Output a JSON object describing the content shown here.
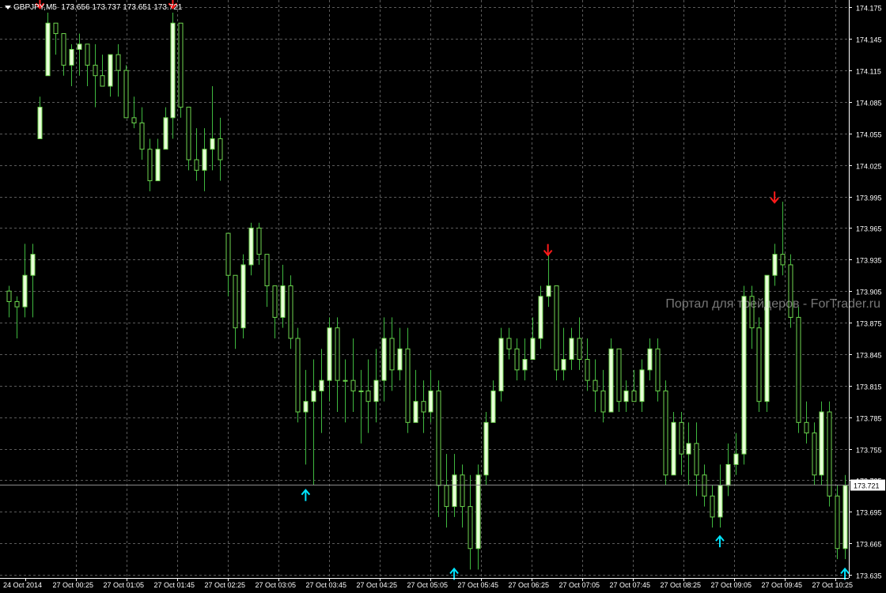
{
  "header": {
    "symbol": "GBPJPY,M5",
    "open": "173.656",
    "high": "173.737",
    "low": "173.651",
    "close": "173.721"
  },
  "watermark": "Портал для трейдеров - ForTrader.ru",
  "current_price_label": "173.721",
  "colors": {
    "background": "#000000",
    "grid": "#5a5a5a",
    "bull_body": "#e8ffd8",
    "bear_body": "#000000",
    "candle_outline": "#6fd64f",
    "wick": "#3fb83f",
    "axis_text": "#ffffff",
    "arrow_down": "#ff1a1a",
    "arrow_up": "#00e5ff"
  },
  "chart_data": {
    "type": "candlestick",
    "y_ticks": [
      "174.175",
      "174.145",
      "174.115",
      "174.085",
      "174.055",
      "174.025",
      "173.995",
      "173.965",
      "173.935",
      "173.905",
      "173.875",
      "173.845",
      "173.815",
      "173.785",
      "173.755",
      "173.725",
      "173.695",
      "173.665",
      "173.635"
    ],
    "x_ticks": [
      "24 Oct 2014",
      "27 Oct 00:25",
      "27 Oct 01:05",
      "27 Oct 01:45",
      "27 Oct 02:25",
      "27 Oct 03:05",
      "27 Oct 03:45",
      "27 Oct 04:25",
      "27 Oct 05:05",
      "27 Oct 05:45",
      "27 Oct 06:25",
      "27 Oct 07:05",
      "27 Oct 07:45",
      "27 Oct 08:25",
      "27 Oct 09:05",
      "27 Oct 09:45",
      "27 Oct 10:25"
    ],
    "ylim": [
      173.632,
      174.182
    ],
    "current_price": 173.721,
    "candles": [
      [
        173.905,
        173.895,
        173.91,
        173.88
      ],
      [
        173.895,
        173.89,
        173.9,
        173.86
      ],
      [
        173.89,
        173.92,
        173.95,
        173.88
      ],
      [
        173.92,
        173.94,
        173.95,
        173.88
      ],
      [
        174.05,
        174.08,
        174.09,
        174.05
      ],
      [
        174.11,
        174.16,
        174.17,
        174.11
      ],
      [
        174.16,
        174.15,
        174.16,
        174.13
      ],
      [
        174.15,
        174.12,
        174.15,
        174.11
      ],
      [
        174.12,
        174.135,
        174.14,
        174.1
      ],
      [
        174.135,
        174.14,
        174.15,
        174.11
      ],
      [
        174.14,
        174.12,
        174.13,
        174.1
      ],
      [
        174.12,
        174.11,
        174.14,
        174.08
      ],
      [
        174.11,
        174.1,
        174.13,
        174.1
      ],
      [
        174.1,
        174.13,
        174.13,
        174.09
      ],
      [
        174.13,
        174.115,
        174.14,
        174.09
      ],
      [
        174.115,
        174.07,
        174.12,
        174.07
      ],
      [
        174.07,
        174.065,
        174.09,
        174.06
      ],
      [
        174.065,
        174.04,
        174.08,
        174.03
      ],
      [
        174.04,
        174.01,
        174.05,
        174.0
      ],
      [
        174.01,
        174.04,
        174.05,
        174.01
      ],
      [
        174.04,
        174.07,
        174.08,
        174.04
      ],
      [
        174.07,
        174.16,
        174.17,
        174.05
      ],
      [
        174.16,
        174.08,
        174.16,
        174.07
      ],
      [
        174.08,
        174.03,
        174.08,
        174.02
      ],
      [
        174.03,
        174.02,
        174.06,
        174.01
      ],
      [
        174.02,
        174.04,
        174.06,
        174.0
      ],
      [
        174.04,
        174.05,
        174.1,
        174.02
      ],
      [
        174.05,
        174.03,
        174.07,
        174.01
      ],
      [
        173.96,
        173.92,
        173.96,
        173.9
      ],
      [
        173.92,
        173.87,
        173.92,
        173.85
      ],
      [
        173.87,
        173.93,
        173.94,
        173.86
      ],
      [
        173.93,
        173.965,
        173.97,
        173.92
      ],
      [
        173.965,
        173.94,
        173.97,
        173.93
      ],
      [
        173.94,
        173.91,
        173.94,
        173.89
      ],
      [
        173.91,
        173.88,
        173.91,
        173.86
      ],
      [
        173.88,
        173.91,
        173.93,
        173.87
      ],
      [
        173.91,
        173.86,
        173.92,
        173.85
      ],
      [
        173.86,
        173.79,
        173.87,
        173.78
      ],
      [
        173.79,
        173.8,
        173.83,
        173.74
      ],
      [
        173.8,
        173.81,
        173.84,
        173.72
      ],
      [
        173.81,
        173.82,
        173.85,
        173.77
      ],
      [
        173.82,
        173.87,
        173.88,
        173.8
      ],
      [
        173.87,
        173.82,
        173.88,
        173.79
      ],
      [
        173.82,
        173.82,
        173.84,
        173.78
      ],
      [
        173.82,
        173.81,
        173.86,
        173.79
      ],
      [
        173.81,
        173.81,
        173.83,
        173.76
      ],
      [
        173.81,
        173.8,
        173.84,
        173.77
      ],
      [
        173.8,
        173.82,
        173.85,
        173.78
      ],
      [
        173.82,
        173.86,
        173.88,
        173.8
      ],
      [
        173.86,
        173.83,
        173.88,
        173.81
      ],
      [
        173.83,
        173.85,
        173.87,
        173.82
      ],
      [
        173.85,
        173.78,
        173.87,
        173.77
      ],
      [
        173.78,
        173.8,
        173.83,
        173.78
      ],
      [
        173.8,
        173.79,
        173.82,
        173.77
      ],
      [
        173.79,
        173.81,
        173.83,
        173.78
      ],
      [
        173.81,
        173.72,
        173.82,
        173.69
      ],
      [
        173.72,
        173.7,
        173.75,
        173.68
      ],
      [
        173.7,
        173.73,
        173.75,
        173.69
      ],
      [
        173.73,
        173.7,
        173.74,
        173.68
      ],
      [
        173.7,
        173.66,
        173.73,
        173.64
      ],
      [
        173.66,
        173.73,
        173.74,
        173.64
      ],
      [
        173.73,
        173.78,
        173.79,
        173.72
      ],
      [
        173.78,
        173.81,
        173.82,
        173.78
      ],
      [
        173.81,
        173.86,
        173.87,
        173.8
      ],
      [
        173.86,
        173.85,
        173.87,
        173.84
      ],
      [
        173.85,
        173.83,
        173.86,
        173.82
      ],
      [
        173.83,
        173.84,
        173.86,
        173.82
      ],
      [
        173.84,
        173.86,
        173.88,
        173.84
      ],
      [
        173.86,
        173.9,
        173.91,
        173.85
      ],
      [
        173.9,
        173.91,
        173.94,
        173.89
      ],
      [
        173.91,
        173.83,
        173.91,
        173.82
      ],
      [
        173.83,
        173.84,
        173.87,
        173.82
      ],
      [
        173.84,
        173.86,
        173.87,
        173.83
      ],
      [
        173.86,
        173.84,
        173.88,
        173.83
      ],
      [
        173.84,
        173.82,
        173.86,
        173.81
      ],
      [
        173.82,
        173.81,
        173.84,
        173.79
      ],
      [
        173.81,
        173.79,
        173.83,
        173.78
      ],
      [
        173.79,
        173.85,
        173.86,
        173.79
      ],
      [
        173.85,
        173.8,
        173.85,
        173.79
      ],
      [
        173.8,
        173.81,
        173.82,
        173.79
      ],
      [
        173.81,
        173.8,
        173.83,
        173.8
      ],
      [
        173.8,
        173.83,
        173.84,
        173.79
      ],
      [
        173.83,
        173.85,
        173.86,
        173.82
      ],
      [
        173.85,
        173.81,
        173.86,
        173.8
      ],
      [
        173.81,
        173.73,
        173.82,
        173.72
      ],
      [
        173.73,
        173.78,
        173.79,
        173.73
      ],
      [
        173.78,
        173.75,
        173.79,
        173.73
      ],
      [
        173.75,
        173.76,
        173.78,
        173.72
      ],
      [
        173.76,
        173.73,
        173.78,
        173.71
      ],
      [
        173.73,
        173.71,
        173.74,
        173.7
      ],
      [
        173.71,
        173.69,
        173.72,
        173.68
      ],
      [
        173.69,
        173.72,
        173.74,
        173.68
      ],
      [
        173.72,
        173.74,
        173.76,
        173.71
      ],
      [
        173.74,
        173.75,
        173.77,
        173.73
      ],
      [
        173.75,
        173.9,
        173.91,
        173.74
      ],
      [
        173.9,
        173.87,
        173.91,
        173.85
      ],
      [
        173.87,
        173.8,
        173.88,
        173.79
      ],
      [
        173.8,
        173.92,
        173.92,
        173.79
      ],
      [
        173.92,
        173.94,
        173.95,
        173.91
      ],
      [
        173.94,
        173.93,
        173.99,
        173.92
      ],
      [
        173.93,
        173.88,
        173.94,
        173.87
      ],
      [
        173.88,
        173.78,
        173.89,
        173.77
      ],
      [
        173.78,
        173.77,
        173.8,
        173.76
      ],
      [
        173.77,
        173.73,
        173.78,
        173.72
      ],
      [
        173.73,
        173.79,
        173.8,
        173.72
      ],
      [
        173.79,
        173.71,
        173.8,
        173.7
      ],
      [
        173.71,
        173.66,
        173.72,
        173.65
      ],
      [
        173.66,
        173.72,
        173.73,
        173.65
      ]
    ],
    "signals": [
      {
        "dir": "down",
        "candle": 4,
        "price": 174.178
      },
      {
        "dir": "down",
        "candle": 21,
        "price": 174.178
      },
      {
        "dir": "up",
        "candle": 38,
        "price": 173.712
      },
      {
        "dir": "up",
        "candle": 57,
        "price": 173.637
      },
      {
        "dir": "down",
        "candle": 69,
        "price": 173.943
      },
      {
        "dir": "up",
        "candle": 91,
        "price": 173.668
      },
      {
        "dir": "down",
        "candle": 98,
        "price": 173.993
      },
      {
        "dir": "up",
        "candle": 107,
        "price": 173.637
      }
    ]
  }
}
